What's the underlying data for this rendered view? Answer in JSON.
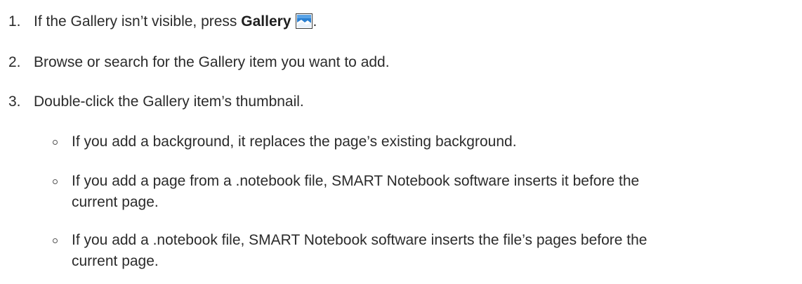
{
  "steps": [
    {
      "number": "1.",
      "text_before": "If the Gallery isn’t visible, press ",
      "bold": "Gallery",
      "icon": "gallery-icon",
      "text_after": "."
    },
    {
      "number": "2.",
      "text": "Browse or search for the Gallery item you want to add."
    },
    {
      "number": "3.",
      "text": "Double-click the Gallery item’s thumbnail."
    }
  ],
  "sub_bullets": [
    {
      "line1": "If you add a background, it replaces the page’s existing background."
    },
    {
      "line1": "If you add a page from a .notebook file, SMART Notebook software inserts it before the",
      "line2": "current page."
    },
    {
      "line1": "If you add a .notebook file, SMART Notebook software inserts the file’s pages before the",
      "line2": "current page."
    }
  ],
  "colors": {
    "text": "#2b2b2b",
    "icon_blue": "#1a73c9",
    "icon_frame": "#3b3b3b"
  }
}
